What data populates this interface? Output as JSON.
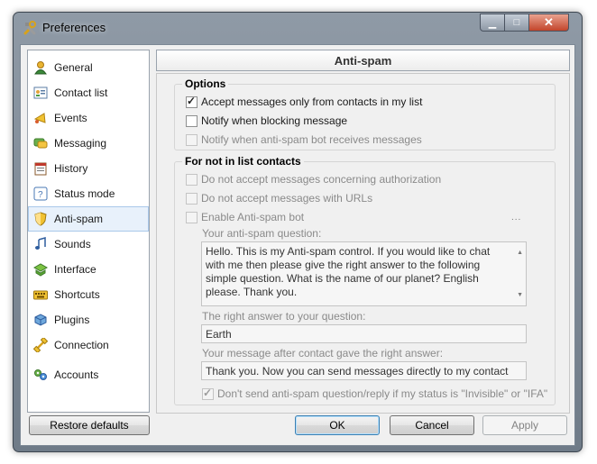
{
  "window": {
    "title": "Preferences",
    "icon": "tools-icon"
  },
  "sidebar": {
    "items": [
      {
        "label": "General",
        "icon": "general-icon",
        "active": false
      },
      {
        "label": "Contact list",
        "icon": "contact-list-icon",
        "active": false
      },
      {
        "label": "Events",
        "icon": "events-icon",
        "active": false
      },
      {
        "label": "Messaging",
        "icon": "messaging-icon",
        "active": false
      },
      {
        "label": "History",
        "icon": "history-icon",
        "active": false
      },
      {
        "label": "Status mode",
        "icon": "status-mode-icon",
        "active": false
      },
      {
        "label": "Anti-spam",
        "icon": "shield-icon",
        "active": true
      },
      {
        "label": "Sounds",
        "icon": "sounds-icon",
        "active": false
      },
      {
        "label": "Interface",
        "icon": "interface-icon",
        "active": false
      },
      {
        "label": "Shortcuts",
        "icon": "keyboard-icon",
        "active": false
      },
      {
        "label": "Plugins",
        "icon": "plugins-icon",
        "active": false
      },
      {
        "label": "Connection",
        "icon": "connection-icon",
        "active": false
      },
      {
        "label": "Accounts",
        "icon": "accounts-icon",
        "active": false
      }
    ]
  },
  "header": {
    "title": "Anti-spam"
  },
  "options": {
    "title": "Options",
    "accept_only_contacts": {
      "label": "Accept messages only from contacts in my list",
      "checked": true,
      "enabled": true
    },
    "notify_blocking": {
      "label": "Notify when blocking message",
      "checked": false,
      "enabled": true
    },
    "notify_bot": {
      "label": "Notify when anti-spam bot receives messages",
      "checked": false,
      "enabled": false
    }
  },
  "not_in_list": {
    "title": "For not in list contacts",
    "no_authorization": {
      "label": "Do not accept messages concerning authorization",
      "checked": false,
      "enabled": false
    },
    "no_urls": {
      "label": "Do not accept messages with URLs",
      "checked": false,
      "enabled": false
    },
    "enable_bot": {
      "label": "Enable Anti-spam bot",
      "checked": false,
      "enabled": false
    },
    "more_dots": "...",
    "question_label": "Your anti-spam question:",
    "question_value": "Hello. This is my Anti-spam control. If you would like to chat with me then please give the right answer to the following simple question. What is the name of our planet? English please. Thank you.",
    "answer_label": "The right answer to your question:",
    "answer_value": "Earth",
    "after_label": "Your message after contact gave the right answer:",
    "after_value": "Thank you. Now you can send messages directly to my contact list.",
    "dont_send_invisible": {
      "label": "Don't send anti-spam question/reply if my status is \"Invisible\" or \"IFA\"",
      "checked": true,
      "enabled": false
    }
  },
  "buttons": {
    "restore": "Restore defaults",
    "ok": "OK",
    "cancel": "Cancel",
    "apply": "Apply"
  },
  "colors": {
    "active_item_bg": "#e8f1fb",
    "active_item_border": "#a9c8ea",
    "window_frame": "#7b8794"
  }
}
